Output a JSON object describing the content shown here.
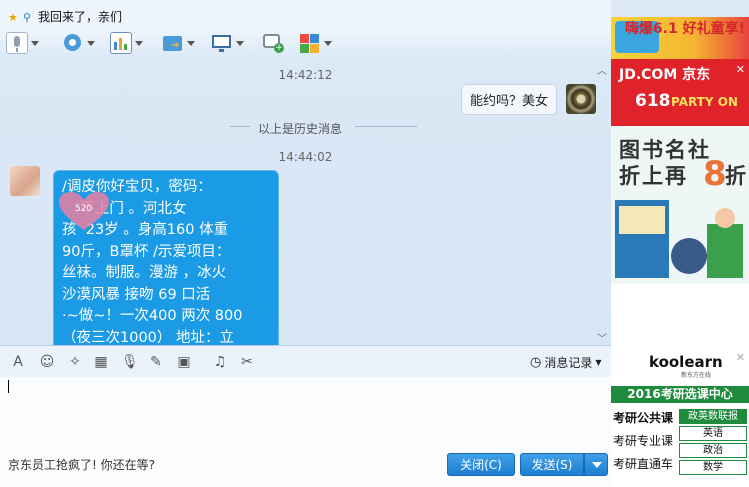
{
  "header": {
    "status_text": "我回来了，亲们"
  },
  "toolbar": {
    "items": [
      "voice-call",
      "video-call",
      "remote-assist",
      "send-file",
      "screen-share",
      "create-discussion",
      "apps"
    ]
  },
  "chat": {
    "messages": [
      {
        "time": "14:42:12",
        "direction": "outgoing",
        "text": "能约吗？美女"
      },
      {
        "separator": "以上是历史消息"
      },
      {
        "time": "14:44:02",
        "direction": "incoming",
        "text": "/调皮你好宝贝，密码：\n    不上门 。河北女\n孩  23岁 。身高160 体重\n90斤，B罩杯 /示爱项目：\n丝袜。制服。漫游 ，冰火\n沙漠风暴 接吻 69 口活\n·~做~！一次400 两次 800\n（夜三次1000） 地址：立\n水桥地铁附近 欢迎来玩"
      }
    ],
    "sticker_text": "520"
  },
  "input_toolbar": {
    "message_record_label": "消息记录"
  },
  "footer": {
    "ad_link": "京东员工抢疯了! 你还在等?",
    "close_label": "关闭(C)",
    "send_label": "发送(S)"
  },
  "ads": {
    "top_banner": "嗨爆6.1 好礼童享!",
    "jd_logo": "JD.COM 京东",
    "jd_618": "618",
    "jd_party": "PARTY ON",
    "books_line1": "图书名社",
    "books_line2": "折上再",
    "books_8": "8",
    "books_suffix": "折",
    "koolearn_logo": "koolearn",
    "koolearn_sub": "新东方在线",
    "koolearn_banner": "2016考研选课中心",
    "koolearn_rows": [
      "考研公共课",
      "考研专业课",
      "考研直通车"
    ],
    "koolearn_tags": [
      "政英数联报",
      "英语",
      "政治",
      "数学"
    ]
  },
  "colors": {
    "bubble_blue": "#1b9be6",
    "jd_red": "#e0222a",
    "koolearn_green": "#1e8c3c",
    "button_blue": "#1d7fd0"
  }
}
